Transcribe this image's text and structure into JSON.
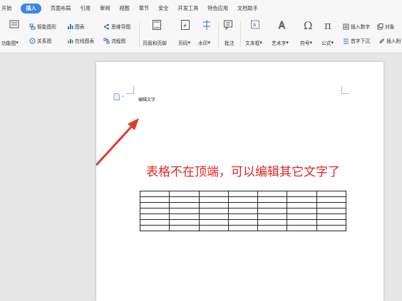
{
  "menu": {
    "tabs": [
      "开始",
      "插入",
      "页面布局",
      "引用",
      "审阅",
      "视图",
      "章节",
      "安全",
      "开发工具",
      "特色应用",
      "文档助手"
    ],
    "active": "插入"
  },
  "ribbon": {
    "func_chart": "功能图",
    "smart_shape": "智能图形",
    "chart": "图表",
    "mind_map": "思维导图",
    "relation": "关系图",
    "online_chart": "在线图表",
    "flow_chart": "流程图",
    "header_footer": "页眉和页脚",
    "page_num": "页码",
    "watermark": "水印",
    "comment": "批注",
    "textbox": "文本框",
    "art_text": "艺术字",
    "symbol": "符号",
    "formula": "公式",
    "insert_number": "插入数字",
    "drop_cap": "首字下沉",
    "object": "对象",
    "insert_attach": "插入附"
  },
  "doc": {
    "header_text": "编辑文字",
    "annotation": "表格不在顶端，可以编辑其它文字了",
    "table": {
      "rows": 7,
      "cols": 7
    }
  }
}
